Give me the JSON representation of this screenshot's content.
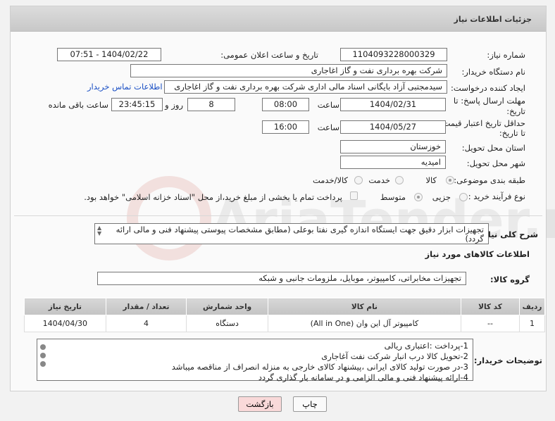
{
  "header": {
    "title": "جزئیات اطلاعات نیاز"
  },
  "form": {
    "need_number_label": "شماره نیاز:",
    "need_number": "1104093228000329",
    "announce_label": "تاریخ و ساعت اعلان عمومی:",
    "announce_value": "1404/02/22 - 07:51",
    "buyer_label": "نام دستگاه خریدار:",
    "buyer_value": "شرکت بهره برداری نفت و گاز اغاجاری",
    "creator_label": "ایجاد کننده درخواست:",
    "creator_value": "سیدمجتبی آزاد بایگانی اسناد مالی اداری شرکت بهره برداری نفت و گاز اغاجاری",
    "contact_link": "اطلاعات تماس خریدار",
    "deadline_label_1": "مهلت ارسال پاسخ: تا",
    "deadline_label_2": "تاریخ:",
    "deadline_date": "1404/02/31",
    "time_label": "ساعت",
    "deadline_time": "08:00",
    "days_value": "8",
    "days_label": "روز و",
    "remaining_time": "23:45:15",
    "remaining_label": "ساعت باقی مانده",
    "validity_label_1": "حداقل تاریخ اعتبار قیمت:",
    "validity_label_2": "تا تاریخ:",
    "validity_date": "1404/05/27",
    "validity_time": "16:00",
    "province_label": "استان محل تحویل:",
    "province_value": "خوزستان",
    "city_label": "شهر محل تحویل:",
    "city_value": "امیدیه",
    "category_label": "طبقه بندی موضوعی:",
    "category_options": [
      "کالا",
      "خدمت",
      "کالا/خدمت"
    ],
    "process_label": "نوع فرآیند خرید :",
    "process_options": [
      "جزیی",
      "متوسط"
    ],
    "payment_note": "پرداخت تمام یا بخشی از مبلغ خرید،از محل \"اسناد خزانه اسلامی\" خواهد بود."
  },
  "description": {
    "label": "شرح کلی نیاز:",
    "text": "تجهیزات ابزار دقیق جهت ایستگاه اندازه گیری نفتا بوعلی (مطابق مشخصات پیوستی پیشنهاد فنی و مالی ارائه گردد)"
  },
  "goods": {
    "section_title": "اطلاعات کالاهای مورد نیاز",
    "group_label": "گروه کالا:",
    "group_value": "تجهیزات مخابراتی، کامپیوتر، موبایل، ملزومات جانبی و شبکه",
    "columns": [
      "ردیف",
      "کد کالا",
      "نام کالا",
      "واحد شمارش",
      "تعداد / مقدار",
      "تاریخ نیاز"
    ],
    "rows": [
      {
        "row": "1",
        "code": "--",
        "name": "کامپیوتر آل این وان (All in One)",
        "unit": "دستگاه",
        "qty": "4",
        "date": "1404/04/30"
      }
    ]
  },
  "notes": {
    "label": "توضیحات خریدار:",
    "lines": [
      "1-پرداخت :اعتباری ریالی",
      "2-تحویل کالا درب انبار شرکت نفت آغاجاری",
      "3-در صورت تولید کالای ایرانی ،پیشنهاد کالای خارجی به منزله انصراف از مناقصه میباشد",
      "4-ارائه پیشنهاد فنی و مالی الزامی و در سامانه بار گذاری گردد"
    ]
  },
  "buttons": {
    "print": "چاپ",
    "back": "بازگشت"
  },
  "watermark": {
    "text": "AriaTender.neT"
  },
  "colors": {
    "link": "#1a4fc4",
    "back_button_bg": "#f9d9d9",
    "header_bg": "#d0d0d0"
  }
}
